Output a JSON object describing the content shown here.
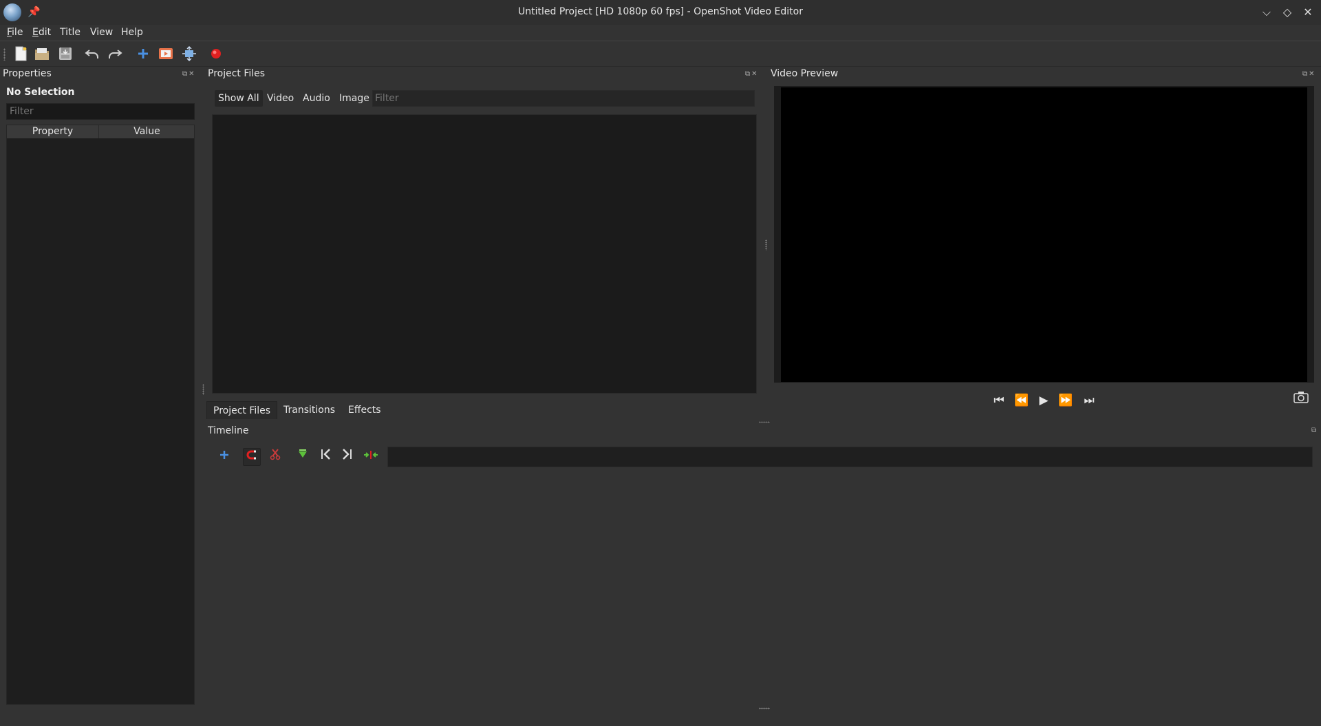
{
  "window": {
    "title": "Untitled Project [HD 1080p 60 fps] - OpenShot Video Editor",
    "controls": {
      "minimize": "⌵",
      "maximize": "◇",
      "close": "✕"
    }
  },
  "menu": {
    "file": {
      "underline": "F",
      "rest": "ile"
    },
    "edit": {
      "underline": "E",
      "rest": "dit"
    },
    "title": "Title",
    "view": "View",
    "help": "Help"
  },
  "toolbar": {
    "icons": [
      "new-project-icon",
      "open-project-icon",
      "save-project-icon",
      "undo-icon",
      "redo-icon",
      "import-files-icon",
      "profile-icon",
      "fullscreen-icon",
      "record-icon"
    ]
  },
  "properties": {
    "title": "Properties",
    "selection": "No Selection",
    "filter_placeholder": "Filter",
    "columns": {
      "property": "Property",
      "value": "Value"
    }
  },
  "project_files": {
    "title": "Project Files",
    "filter_tabs": {
      "show_all": "Show All",
      "video": "Video",
      "audio": "Audio",
      "image": "Image"
    },
    "filter_placeholder": "Filter",
    "bottom_tabs": {
      "files": "Project Files",
      "transitions": "Transitions",
      "effects": "Effects"
    }
  },
  "video_preview": {
    "title": "Video Preview",
    "controls": {
      "start": "⏮",
      "rewind": "⏪",
      "play": "▶",
      "fast_forward": "⏩",
      "end": "⏭"
    }
  },
  "timeline": {
    "title": "Timeline"
  },
  "colors": {
    "background": "#333333",
    "panel_dark": "#1b1b1b",
    "video": "#000000",
    "record": "#e02020",
    "accent_blue": "#4a90e2",
    "accent_green": "#5cc13a"
  }
}
